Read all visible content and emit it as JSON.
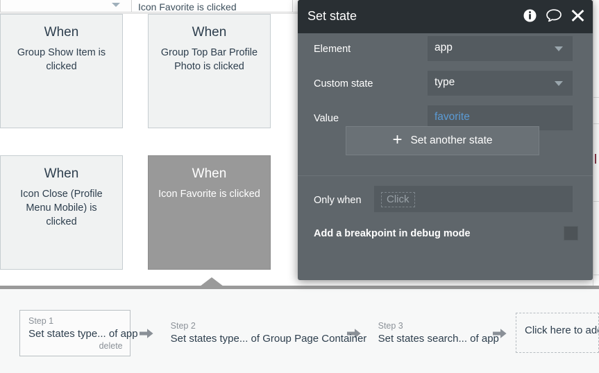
{
  "app": {
    "top_strip": {
      "dropdown_value": "",
      "field_text": "Icon Favorite is clicked"
    },
    "events": [
      {
        "id": "ev-a",
        "when_label": "When",
        "description": "Group Show Item is clicked",
        "selected": false
      },
      {
        "id": "ev-b",
        "when_label": "When",
        "description": "Group Top Bar Profile Photo is clicked",
        "selected": false
      },
      {
        "id": "ev-c",
        "when_label": "When",
        "description": "Icon Close (Profile Menu Mobile) is clicked",
        "selected": false
      },
      {
        "id": "ev-d",
        "when_label": "When",
        "description": "Icon Favorite is clicked",
        "selected": true
      }
    ],
    "steps": [
      {
        "number": "Step 1",
        "title": "Set states type... of app",
        "delete_label": "delete",
        "boxed": true
      },
      {
        "number": "Step 2",
        "title": "Set states type... of Group Page Container",
        "delete_label": "",
        "boxed": false
      },
      {
        "number": "Step 3",
        "title": "Set states search... of app",
        "delete_label": "",
        "boxed": false
      }
    ],
    "step_add_label": "Click here to add an action...",
    "arrow_icon": "arrow-right-icon"
  },
  "dialog": {
    "title": "Set state",
    "icons": {
      "info": "info-icon",
      "comment": "comment-icon",
      "close": "close-icon"
    },
    "fields": [
      {
        "label": "Element",
        "value": "app",
        "type": "dropdown",
        "expression": false
      },
      {
        "label": "Custom state",
        "value": "type",
        "type": "dropdown",
        "expression": false
      },
      {
        "label": "Value",
        "value": "favorite",
        "type": "expression",
        "expression": true
      }
    ],
    "set_another_label": "Set another state",
    "set_another_icon": "plus-icon",
    "only_when": {
      "label": "Only when",
      "placeholder": "Click"
    },
    "breakpoint": {
      "label": "Add a breakpoint in debug mode",
      "checked": false
    }
  },
  "colors": {
    "dialog_header": "#292f33",
    "dialog_body": "#5f666b",
    "field_bg": "#545b60",
    "expression_text": "#5b9bd5",
    "selected_event": "#999999",
    "event_bg": "#f0f2f2",
    "panel_bg": "#f7f8f8",
    "panel_border": "#9a9a9a"
  }
}
